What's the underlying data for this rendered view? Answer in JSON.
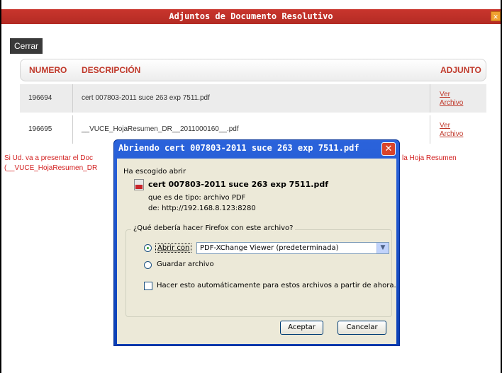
{
  "page": {
    "title": "Adjuntos de Documento Resolutivo",
    "close_label": "Cerrar"
  },
  "table": {
    "headers": [
      "NUMERO",
      "DESCRIPCIÓN",
      "ADJUNTO"
    ],
    "rows": [
      {
        "numero": "196694",
        "descripcion": "cert 007803-2011 suce 263 exp 7511.pdf",
        "link_line1": "Ver",
        "link_line2": "Archivo"
      },
      {
        "numero": "196695",
        "descripcion": "__VUCE_HojaResumen_DR__2011000160__.pdf",
        "link_line1": "Ver",
        "link_line2": "Archivo"
      }
    ]
  },
  "warning": {
    "line1_start": "Si Ud. va a presentar el Doc",
    "line1_end": "la Hoja Resumen",
    "line2_start": "(__VUCE_HojaResumen_DR"
  },
  "dialog": {
    "title": "Abriendo cert 007803-2011 suce 263 exp 7511.pdf",
    "intro": "Ha escogido abrir",
    "filename": "cert 007803-2011 suce 263 exp 7511.pdf",
    "type_label": "que es de tipo:",
    "type_value": "archivo PDF",
    "from_label": "de:",
    "from_value": "http://192.168.8.123:8280",
    "question": "¿Qué debería hacer Firefox con este archivo?",
    "open_with_label": "Abrir con",
    "open_with_app": "PDF-XChange Viewer (predeterminada)",
    "save_label": "Guardar archivo",
    "auto_label": "Hacer esto automáticamente para estos archivos a partir de ahora.",
    "accept_label": "Aceptar",
    "cancel_label": "Cancelar"
  }
}
